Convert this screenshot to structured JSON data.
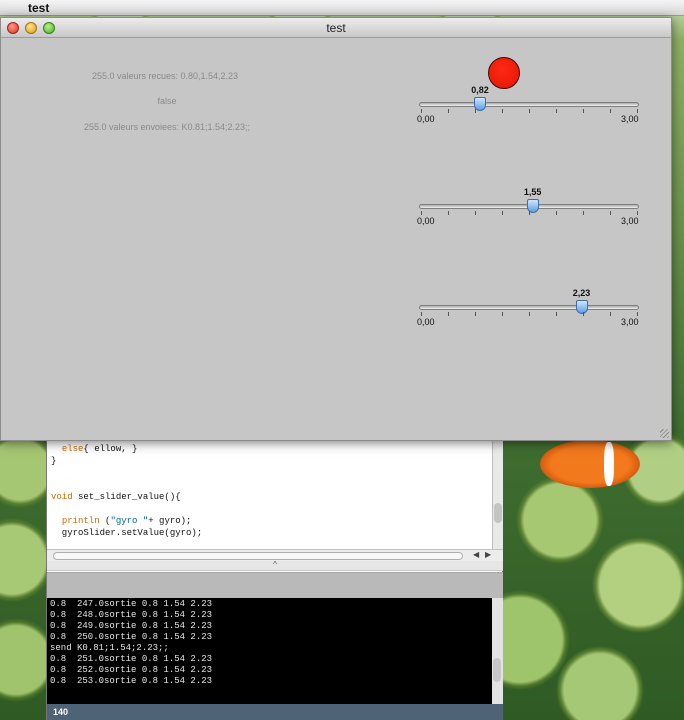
{
  "menubar": {
    "app_name": "test",
    "apple_glyph": ""
  },
  "window": {
    "title": "test",
    "status_lines": {
      "received": "255.0 valeurs recues: 0.80,1.54,2.23",
      "flag": "false",
      "sent": "255.0 valeurs envoiees: K0.81;1.54;2.23;;"
    },
    "led_color": "#ff2a12",
    "sliders": [
      {
        "value_label": "0,82",
        "value": 0.82,
        "min_label": "0,00",
        "max_label": "3,00",
        "min": 0,
        "max": 3
      },
      {
        "value_label": "1,55",
        "value": 1.55,
        "min_label": "0,00",
        "max_label": "3,00",
        "min": 0,
        "max": 3
      },
      {
        "value_label": "2,23",
        "value": 2.23,
        "min_label": "0,00",
        "max_label": "3,00",
        "min": 0,
        "max": 3
      }
    ]
  },
  "ide": {
    "editor_lines": [
      "  else{ ellow, }",
      "}",
      "",
      "",
      "void set_slider_value(){",
      "",
      "  println (\"gyro \"+ gyro);",
      "  gyroSlider.setValue(gyro);"
    ],
    "divider_glyph": "^",
    "console_lines": [
      "0.8  247.0sortie 0.8 1.54 2.23",
      "0.8  248.0sortie 0.8 1.54 2.23",
      "0.8  249.0sortie 0.8 1.54 2.23",
      "0.8  250.0sortie 0.8 1.54 2.23",
      "send K0.81;1.54;2.23;;",
      "0.8  251.0sortie 0.8 1.54 2.23",
      "0.8  252.0sortie 0.8 1.54 2.23",
      "0.8  253.0sortie 0.8 1.54 2.23"
    ],
    "line_number": "140"
  },
  "colors": {
    "thumb": "#5c9ee6",
    "console_bg": "#000000",
    "status_bar": "#4f6377"
  }
}
